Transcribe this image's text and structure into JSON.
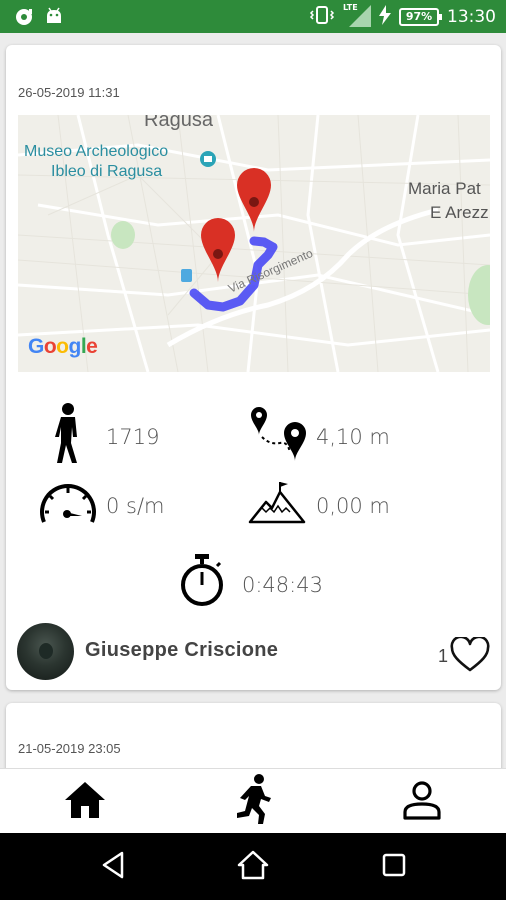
{
  "status_bar": {
    "time": "13:30",
    "battery": "97%",
    "network": "LTE"
  },
  "posts": [
    {
      "date": "26-05-2019 11:31",
      "map": {
        "labels": [
          "Ragusa",
          "Museo Archeologico",
          "Ibleo di Ragusa",
          "Maria Pat",
          "E Arezz",
          "Via Risorgimento"
        ],
        "logo": "Google"
      },
      "stats": {
        "steps": "1719",
        "distance": "4,10 m",
        "pace": "0 s/m",
        "elevation": "0,00 m",
        "duration": "0:48:43"
      },
      "user": "Giuseppe Criscione",
      "likes": "1"
    },
    {
      "date": "21-05-2019 23:05"
    }
  ],
  "bottom_nav": [
    "home-icon",
    "running-icon",
    "profile-icon"
  ],
  "colors": {
    "status_bar": "#2e8b3a",
    "route": "#3f3ff5",
    "marker": "#d93025"
  }
}
